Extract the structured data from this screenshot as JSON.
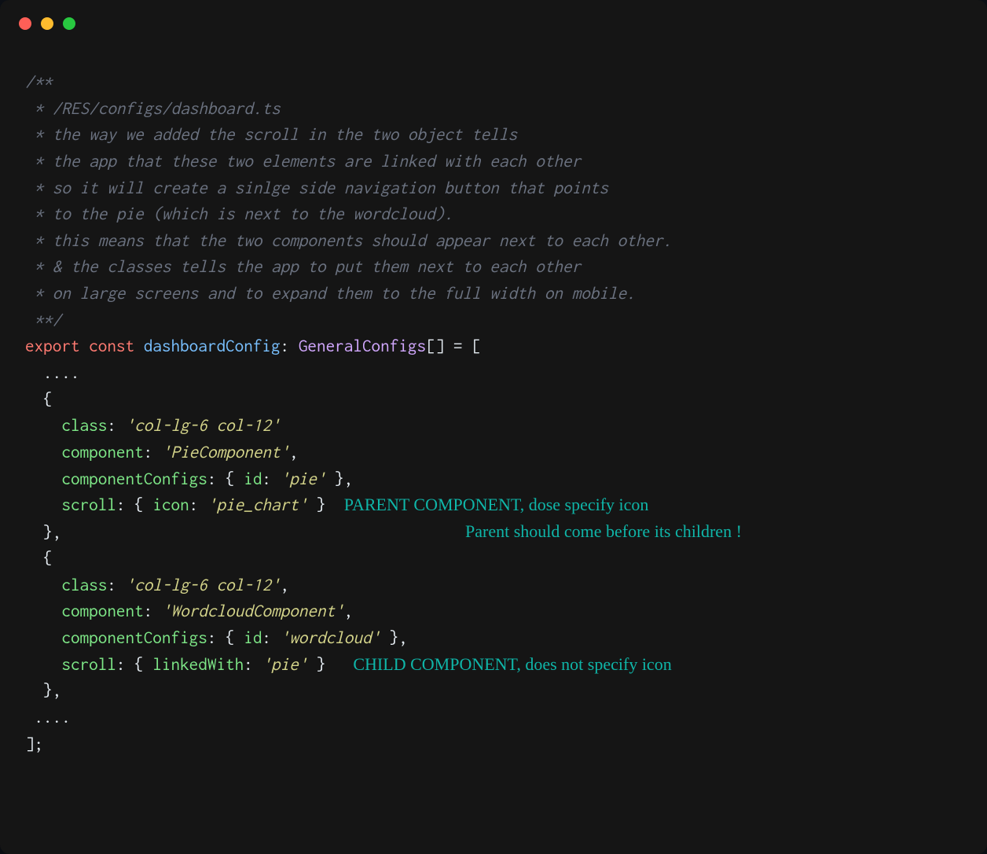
{
  "window": {
    "traffic_lights": [
      "close",
      "minimize",
      "maximize"
    ]
  },
  "code": {
    "comment_lines": [
      "/**",
      " * /RES/configs/dashboard.ts",
      " * the way we added the scroll in the two object tells",
      " * the app that these two elements are linked with each other",
      " * so it will create a sinlge side navigation button that points",
      " * to the pie (which is next to the wordcloud).",
      " * this means that the two components should appear next to each other.",
      " * & the classes tells the app to put them next to each other",
      " * on large screens and to expand them to the full width on mobile.",
      " **/"
    ],
    "decl": {
      "export": "export",
      "const": "const",
      "name": "dashboardConfig",
      "type": "GeneralConfigs",
      "brackets": "[]",
      "eq_open": " = ["
    },
    "ellipsis_top": "  ....",
    "block1": {
      "open": "  {",
      "class_key": "class",
      "class_val": "'col-lg-6 col-12'",
      "component_key": "component",
      "component_val": "'PieComponent'",
      "config_key": "componentConfigs",
      "id_key": "id",
      "id_val": "'pie'",
      "scroll_key": "scroll",
      "icon_key": "icon",
      "icon_val": "'pie_chart'",
      "close": "  },"
    },
    "block2": {
      "open": "  {",
      "class_key": "class",
      "class_val": "'col-lg-6 col-12'",
      "component_key": "component",
      "component_val": "'WordcloudComponent'",
      "config_key": "componentConfigs",
      "id_key": "id",
      "id_val": "'wordcloud'",
      "scroll_key": "scroll",
      "linked_key": "linkedWith",
      "linked_val": "'pie'",
      "close": "  },"
    },
    "ellipsis_bottom": " ....",
    "end": "];"
  },
  "annotations": {
    "parent1": "PARENT COMPONENT, dose specify icon",
    "parent2": "Parent should come before its children !",
    "child": "CHILD COMPONENT, does not specify icon"
  }
}
